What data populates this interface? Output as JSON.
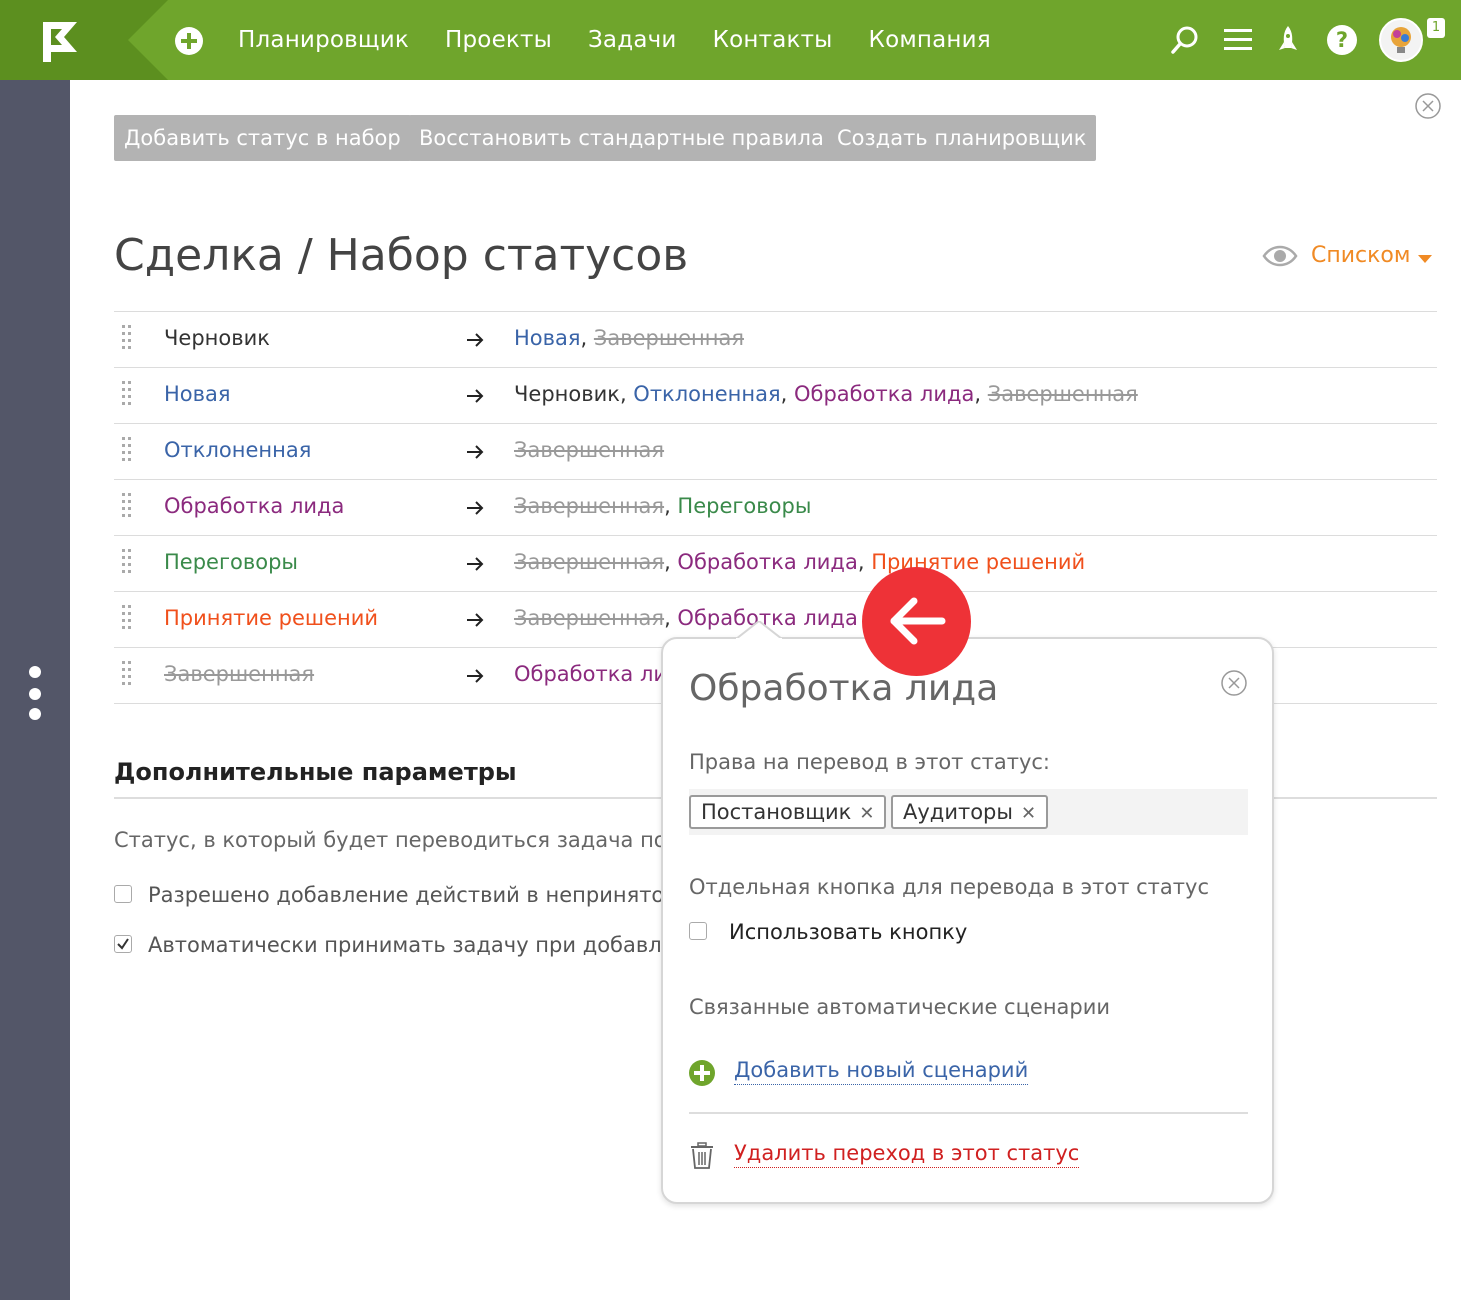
{
  "nav": {
    "items": [
      "Планировщик",
      "Проекты",
      "Задачи",
      "Контакты",
      "Компания"
    ],
    "notifications_count": "1"
  },
  "toolbar": {
    "add_status": "Добавить статус в набор",
    "restore_rules": "Восстановить стандартные правила",
    "create_planner": "Создать планировщик"
  },
  "page": {
    "title": "Сделка / Набор статусов",
    "view_mode": "Списком"
  },
  "statuses": [
    {
      "name": "Черновик",
      "color": "black",
      "targets": [
        {
          "t": "Новая",
          "c": "blue"
        },
        {
          "t": "Завершенная",
          "c": "strike"
        }
      ]
    },
    {
      "name": "Новая",
      "color": "blue",
      "targets": [
        {
          "t": "Черновик",
          "c": "black"
        },
        {
          "t": "Отклоненная",
          "c": "blue"
        },
        {
          "t": "Обработка лида",
          "c": "purple"
        },
        {
          "t": "Завершенная",
          "c": "strike"
        }
      ]
    },
    {
      "name": "Отклоненная",
      "color": "blue",
      "targets": [
        {
          "t": "Завершенная",
          "c": "strike"
        }
      ]
    },
    {
      "name": "Обработка лида",
      "color": "purple",
      "targets": [
        {
          "t": "Завершенная",
          "c": "strike"
        },
        {
          "t": "Переговоры",
          "c": "green"
        }
      ]
    },
    {
      "name": "Переговоры",
      "color": "green",
      "targets": [
        {
          "t": "Завершенная",
          "c": "strike"
        },
        {
          "t": "Обработка лида",
          "c": "purple"
        },
        {
          "t": "Принятие решений",
          "c": "orange"
        }
      ]
    },
    {
      "name": "Принятие решений",
      "color": "orange",
      "targets": [
        {
          "t": "Завершенная",
          "c": "strike"
        },
        {
          "t": "Обработка лида",
          "c": "purple"
        }
      ]
    },
    {
      "name": "Завершенная",
      "color": "strike",
      "targets": [
        {
          "t": "Обработка ли",
          "c": "purple"
        }
      ]
    }
  ],
  "advanced": {
    "title": "Дополнительные параметры",
    "description": "Статус, в который будет переводиться задача по на",
    "option1": "Разрешено добавление действий в непринятой",
    "option1_checked": false,
    "option2": "Автоматически принимать задачу при добавлен",
    "option2_checked": true
  },
  "popup": {
    "title": "Обработка лида",
    "rights_label": "Права на перевод в этот статус:",
    "tags": [
      "Постановщик",
      "Аудиторы"
    ],
    "button_section_label": "Отдельная кнопка для перевода в этот статус",
    "use_button_label": "Использовать кнопку",
    "use_button_checked": false,
    "scenarios_label": "Связанные автоматические сценарии",
    "add_scenario": "Добавить новый сценарий",
    "delete_transition": "Удалить переход в этот статус"
  },
  "colors": {
    "topbar": "#6fa52c",
    "sidebar": "#535668",
    "accent_orange": "#f08a24",
    "back_button": "#ee3237",
    "link_blue": "#3a64a8",
    "delete_red": "#d02020"
  }
}
